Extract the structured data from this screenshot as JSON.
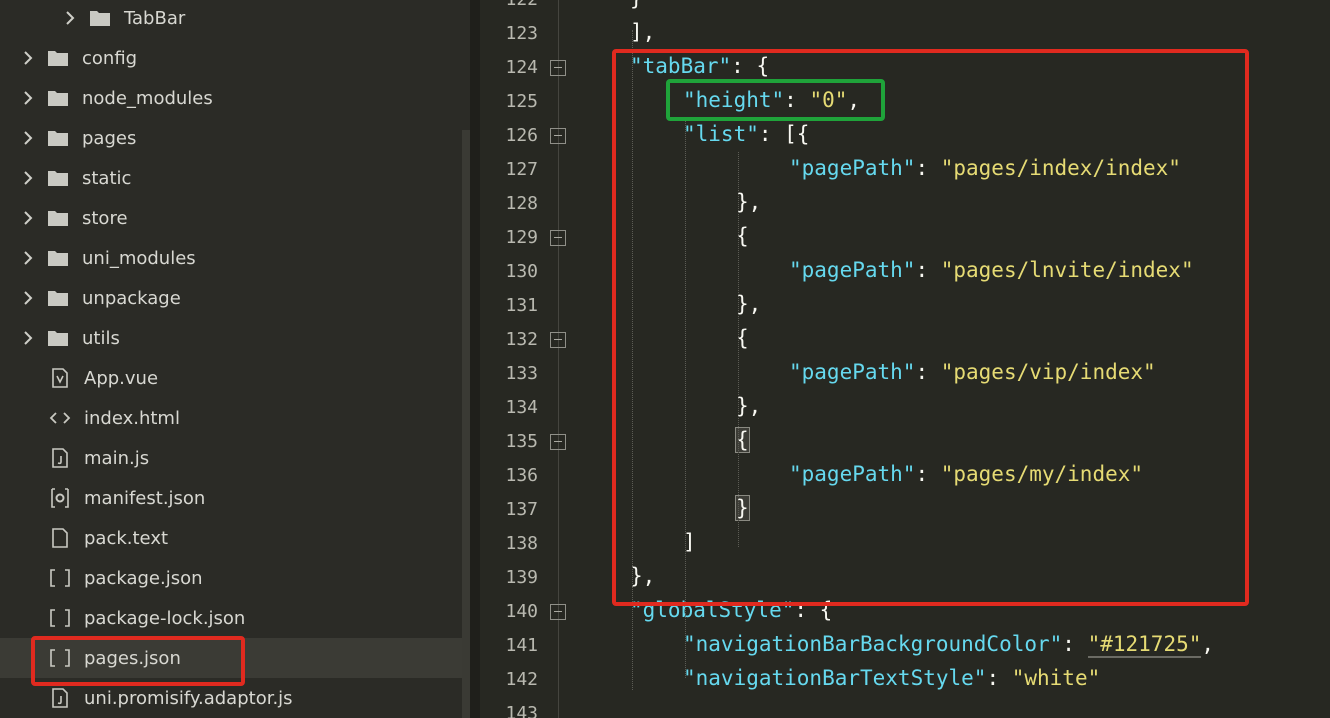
{
  "sidebar": {
    "items": [
      {
        "name": "TabBar",
        "type": "folder"
      },
      {
        "name": "config",
        "type": "folder"
      },
      {
        "name": "node_modules",
        "type": "folder"
      },
      {
        "name": "pages",
        "type": "folder"
      },
      {
        "name": "static",
        "type": "folder"
      },
      {
        "name": "store",
        "type": "folder"
      },
      {
        "name": "uni_modules",
        "type": "folder"
      },
      {
        "name": "unpackage",
        "type": "folder"
      },
      {
        "name": "utils",
        "type": "folder"
      },
      {
        "name": "App.vue",
        "type": "vue-file"
      },
      {
        "name": "index.html",
        "type": "html-file"
      },
      {
        "name": "main.js",
        "type": "js-file"
      },
      {
        "name": "manifest.json",
        "type": "settings-file"
      },
      {
        "name": "pack.text",
        "type": "text-file"
      },
      {
        "name": "package.json",
        "type": "json-file"
      },
      {
        "name": "package-lock.json",
        "type": "json-file"
      },
      {
        "name": "pages.json",
        "type": "json-file"
      },
      {
        "name": "uni.promisify.adaptor.js",
        "type": "js-file"
      }
    ],
    "selected_file": "pages.json"
  },
  "editor": {
    "lines": [
      {
        "n": "122",
        "code": "}"
      },
      {
        "n": "123",
        "code": "],"
      },
      {
        "n": "124",
        "code": "\"tabBar\": {"
      },
      {
        "n": "125",
        "code": "\"height\": \"0\","
      },
      {
        "n": "126",
        "code": "\"list\": [{"
      },
      {
        "n": "127",
        "code": "\"pagePath\": \"pages/index/index\""
      },
      {
        "n": "128",
        "code": "},"
      },
      {
        "n": "129",
        "code": "{"
      },
      {
        "n": "130",
        "code": "\"pagePath\": \"pages/lnvite/index\""
      },
      {
        "n": "131",
        "code": "},"
      },
      {
        "n": "132",
        "code": "{"
      },
      {
        "n": "133",
        "code": "\"pagePath\": \"pages/vip/index\""
      },
      {
        "n": "134",
        "code": "},"
      },
      {
        "n": "135",
        "code": "{"
      },
      {
        "n": "136",
        "code": "\"pagePath\": \"pages/my/index\""
      },
      {
        "n": "137",
        "code": "}"
      },
      {
        "n": "138",
        "code": "]"
      },
      {
        "n": "139",
        "code": "},"
      },
      {
        "n": "140",
        "code": "\"globalStyle\": {"
      },
      {
        "n": "141",
        "code": "\"navigationBarBackgroundColor\": \"#121725\","
      },
      {
        "n": "142",
        "code": "\"navigationBarTextStyle\": \"white\""
      },
      {
        "n": "143",
        "code": ""
      }
    ]
  },
  "colors": {
    "editor_bg": "#272822",
    "sidebar_bg": "#2b2b26",
    "key": "#66d9ef",
    "string": "#e6db74",
    "punctuation": "#f8f8f2",
    "highlight_red": "#e02a1f",
    "highlight_green": "#1fa33a"
  }
}
